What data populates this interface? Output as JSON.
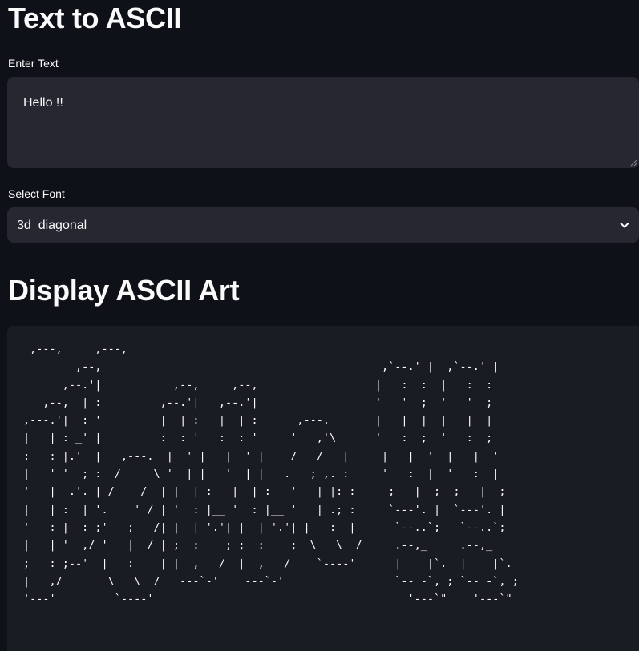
{
  "header": {
    "title": "Text to ASCII"
  },
  "input": {
    "label": "Enter Text",
    "value": "Hello !!"
  },
  "font_select": {
    "label": "Select Font",
    "selected": "3d_diagonal",
    "icon": "chevron-down-icon"
  },
  "output": {
    "heading": "Display ASCII Art",
    "ascii": " ,---,     ,---,\n        ,--,                                           ,`--.' |  ,`--.' |\n      ,--.'|           ,--,     ,--,                  |   :  :  |   :  :\n   ,--,  | :         ,--.'|   ,--.'|                  '   '  ;  '   '  ;\n,---.'|  : '         |  | :   |  | :      ,---.       |   |  |  |   |  |\n|   | : _' |         :  : '   :  : '     '   ,'\\      '   :  ;  '   :  ;\n:   : |.'  |   ,---.  |  ' |   |  ' |    /   /   |     |   |  '  |   |  '\n|   ' '  ; :  /     \\ '  | |   '  | |   .   ; ,. :     '   :  |  '   :  |\n'   |  .'. | /    /  | |  | :   |  | :   '   | |: :     ;   |  ;  ;   |  ;\n|   | :  | '.    ' / | '  : |__ '  : |__ '   | .; :     `---'. |  `---'. |\n'   : |  : ;'   ;   /| |  | '.'| |  | '.'| |   :  |      `--..`;   `--..`;\n|   | '  ,/ '   |  / | ;  :    ; ;  :    ;  \\   \\  /     .--,_     .--,_\n;   : ;--'  |   :    | |  ,   /  |  ,   /    `----'      |    |`.  |    |`.\n|   ,/       \\   \\  /   ---`-'    ---`-'                 `-- -`, ; `-- -`, ;\n'---'         `----'                                       '---`\"    '---`\""
  }
}
